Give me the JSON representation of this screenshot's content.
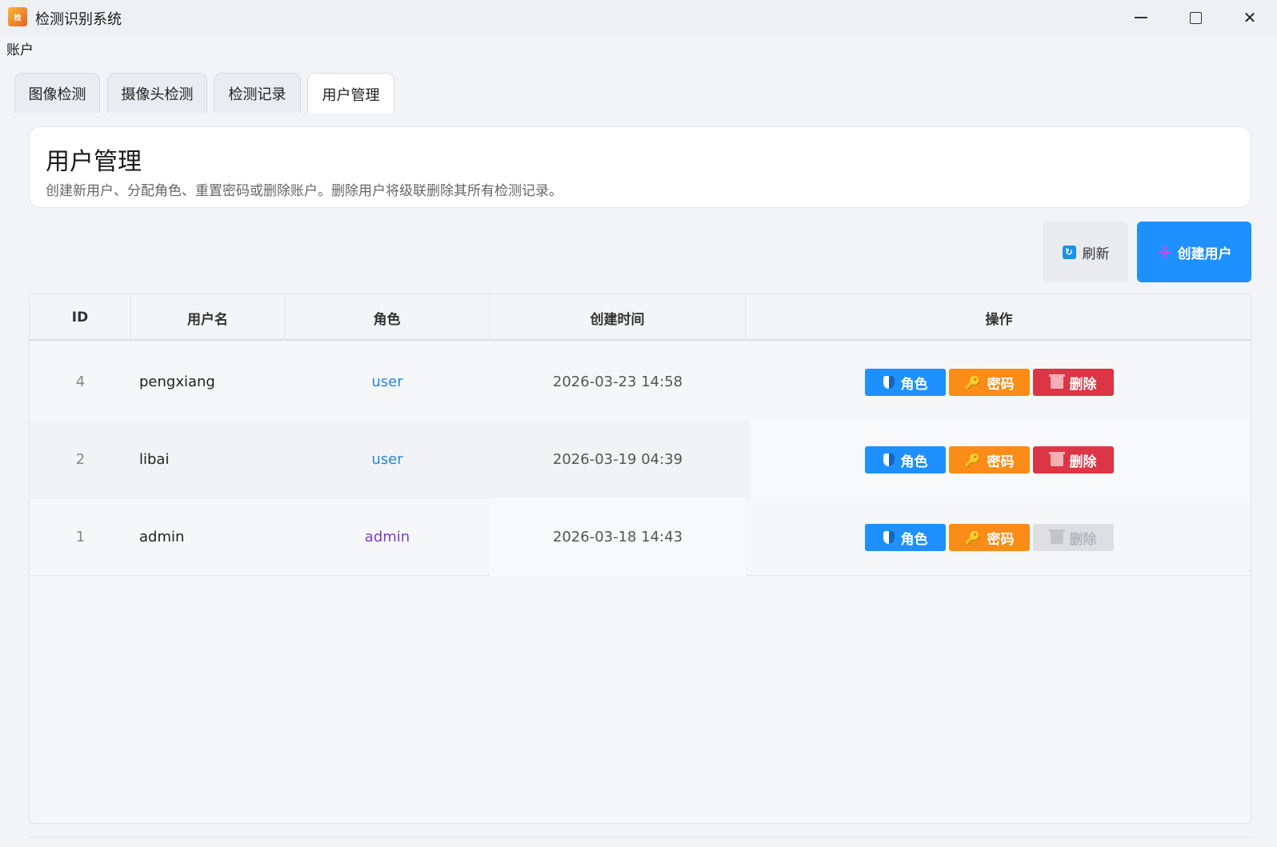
{
  "window": {
    "title": "检测识别系统",
    "logo_text": "检"
  },
  "menu": {
    "account": "账户"
  },
  "tabs": [
    {
      "label": "图像检测",
      "active": false
    },
    {
      "label": "摄像头检测",
      "active": false
    },
    {
      "label": "检测记录",
      "active": false
    },
    {
      "label": "用户管理",
      "active": true
    }
  ],
  "header": {
    "title": "用户管理",
    "description": "创建新用户、分配角色、重置密码或删除账户。删除用户将级联删除其所有检测记录。"
  },
  "toolbar": {
    "refresh_label": "刷新",
    "create_label": "创建用户"
  },
  "table": {
    "columns": [
      "ID",
      "用户名",
      "角色",
      "创建时间",
      "操作"
    ],
    "rows": [
      {
        "id": "4",
        "username": "pengxiang",
        "role": "user",
        "created": "2026-03-23 14:58",
        "delete_enabled": true
      },
      {
        "id": "2",
        "username": "libai",
        "role": "user",
        "created": "2026-03-19 04:39",
        "delete_enabled": true
      },
      {
        "id": "1",
        "username": "admin",
        "role": "admin",
        "created": "2026-03-18 14:43",
        "delete_enabled": false
      }
    ],
    "actions": {
      "role": "角色",
      "password": "密码",
      "delete": "删除"
    }
  },
  "colors": {
    "primary": "#1e90ff",
    "warning": "#fb8c17",
    "danger": "#dc3545",
    "role_user": "#1e88e5",
    "role_admin": "#7b3fc4"
  },
  "icons": {
    "refresh": "refresh-icon",
    "create": "plus-icon",
    "role": "shield-icon",
    "password": "key-icon",
    "delete": "trash-icon"
  }
}
